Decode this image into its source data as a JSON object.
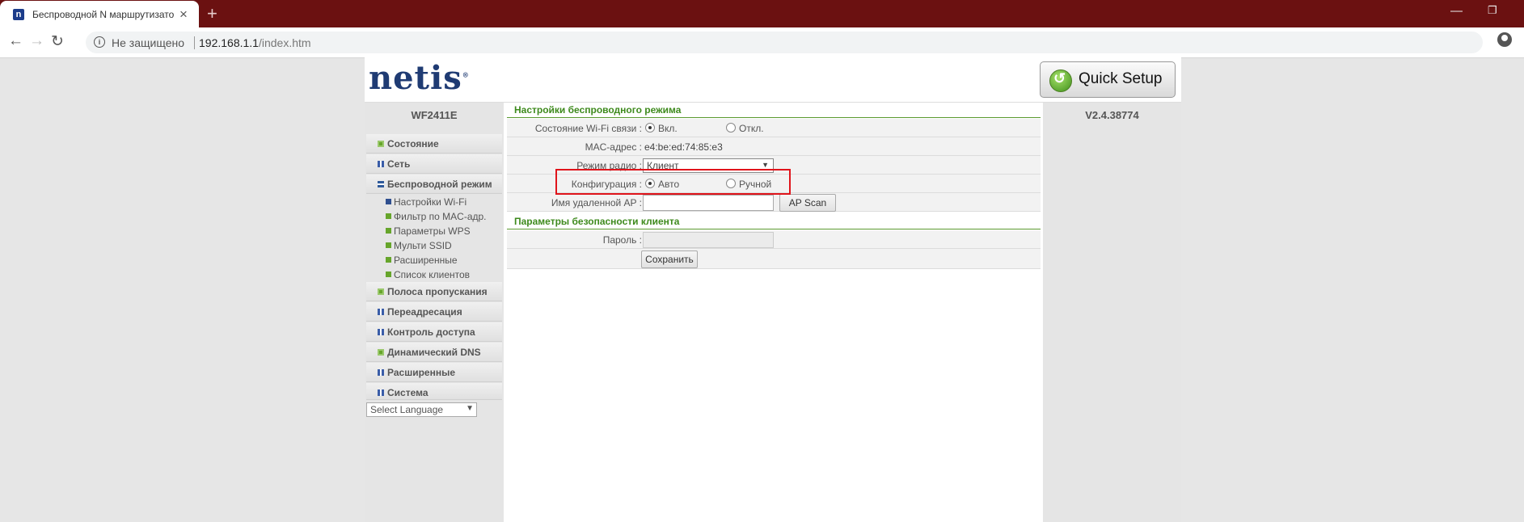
{
  "browser": {
    "tab_title": "Беспроводной N маршрутизато",
    "tab_close": "×",
    "new_tab": "+",
    "security_label": "Не защищено",
    "url_host": "192.168.1.1",
    "url_path": "/index.htm"
  },
  "header": {
    "logo": "netis",
    "logo_mark": "®",
    "quick_setup_label": "Quick Setup"
  },
  "sidebar": {
    "model": "WF2411E",
    "menu": [
      {
        "label": "Состояние"
      },
      {
        "label": "Сеть"
      },
      {
        "label": "Беспроводной режим"
      },
      {
        "label": "Полоса пропускания"
      },
      {
        "label": "Переадресация"
      },
      {
        "label": "Контроль доступа"
      },
      {
        "label": "Динамический DNS"
      },
      {
        "label": "Расширенные"
      },
      {
        "label": "Система"
      }
    ],
    "submenu": [
      {
        "label": "Настройки Wi-Fi"
      },
      {
        "label": "Фильтр по MAC-адр."
      },
      {
        "label": "Параметры WPS"
      },
      {
        "label": "Мульти SSID"
      },
      {
        "label": "Расширенные"
      },
      {
        "label": "Список клиентов"
      }
    ],
    "language": "Select Language"
  },
  "version": "V2.4.38774",
  "wireless": {
    "section_title": "Настройки беспроводного режима",
    "wifi_state_label": "Состояние Wi-Fi связи :",
    "wifi_on": "Вкл.",
    "wifi_off": "Откл.",
    "mac_label": "MAC-адрес :",
    "mac_value": "e4:be:ed:74:85:e3",
    "radio_mode_label": "Режим радио :",
    "radio_mode_value": "Клиент",
    "config_label": "Конфигурация :",
    "config_auto": "Авто",
    "config_manual": "Ручной",
    "remote_ap_label": "Имя удаленной AP :",
    "remote_ap_value": "",
    "ap_scan": "AP Scan"
  },
  "security": {
    "section_title": "Параметры безопасности клиента",
    "password_label": "Пароль :",
    "save": "Сохранить"
  }
}
